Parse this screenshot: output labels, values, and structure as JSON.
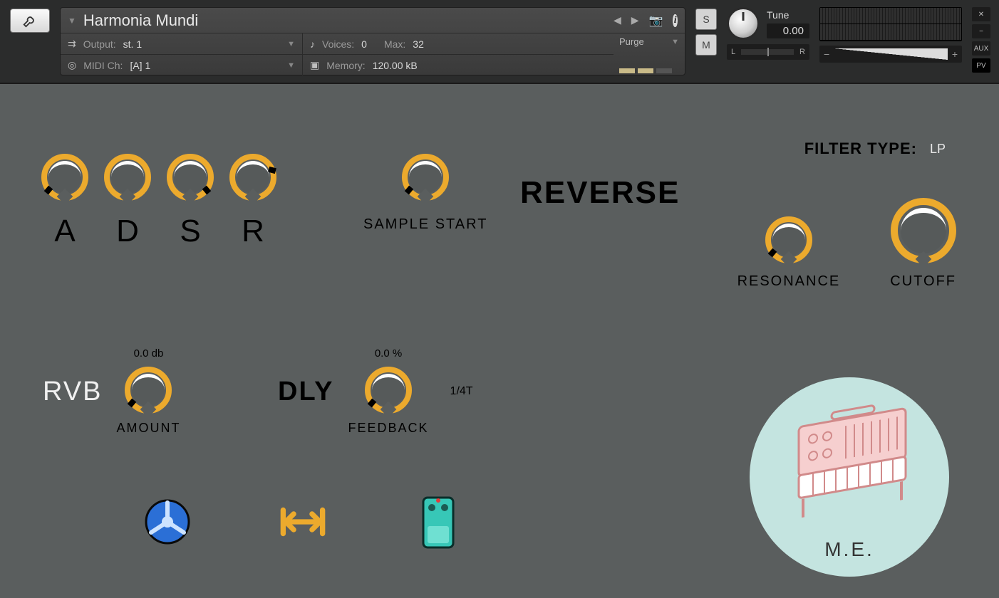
{
  "header": {
    "instrument_name": "Harmonia Mundi",
    "output_label": "Output:",
    "output_value": "st. 1",
    "midi_label": "MIDI Ch:",
    "midi_value": "[A]  1",
    "voices_label": "Voices:",
    "voices_value": "0",
    "voices_max_label": "Max:",
    "voices_max_value": "32",
    "memory_label": "Memory:",
    "memory_value": "120.00 kB",
    "purge_label": "Purge",
    "solo": "S",
    "mute": "M",
    "tune_label": "Tune",
    "tune_value": "0.00",
    "pan_left": "L",
    "pan_right": "R",
    "aux": "AUX",
    "pv": "PV"
  },
  "main": {
    "adsr": {
      "a": "A",
      "d": "D",
      "s": "S",
      "r": "R"
    },
    "sample_start_label": "SAMPLE START",
    "reverse_label": "REVERSE",
    "filter_type_label": "FILTER TYPE:",
    "filter_type_value": "LP",
    "resonance_label": "RESONANCE",
    "cutoff_label": "CUTOFF",
    "rvb_label": "RVB",
    "rvb_value": "0.0 db",
    "rvb_sub": "AMOUNT",
    "dly_label": "DLY",
    "dly_value": "0.0 %",
    "dly_sub": "FEEDBACK",
    "dly_time": "1/4T",
    "logo_text": "M.E."
  }
}
